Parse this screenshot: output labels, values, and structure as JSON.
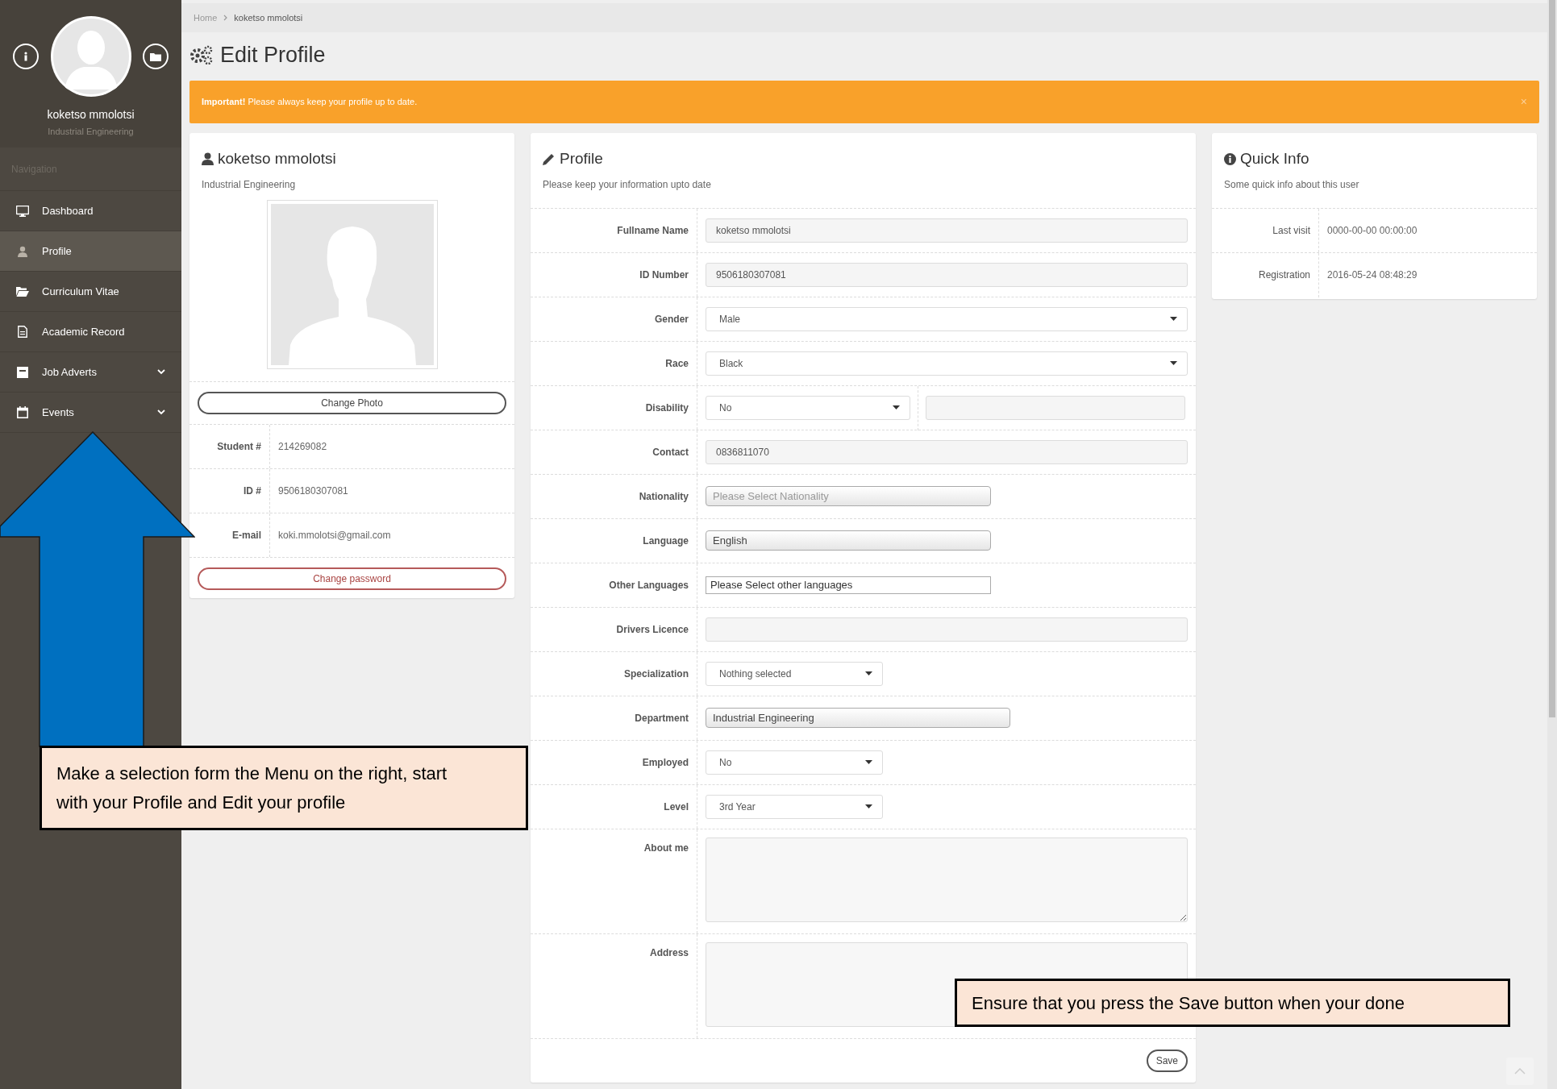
{
  "sidebar": {
    "user_name": "koketso mmolotsi",
    "department": "Industrial Engineering",
    "nav_label": "Navigation",
    "items": [
      {
        "label": "Dashboard",
        "selected": false,
        "has_submenu": false
      },
      {
        "label": "Profile",
        "selected": true,
        "has_submenu": false
      },
      {
        "label": "Curriculum Vitae",
        "selected": false,
        "has_submenu": false
      },
      {
        "label": "Academic Record",
        "selected": false,
        "has_submenu": false
      },
      {
        "label": "Job Adverts",
        "selected": false,
        "has_submenu": true
      },
      {
        "label": "Events",
        "selected": false,
        "has_submenu": true
      }
    ]
  },
  "breadcrumb": [
    "Home",
    "koketso mmolotsi"
  ],
  "page_title": "Edit Profile",
  "alert": {
    "text": "**Important!** Please always keep your profile up to date.",
    "close": "×"
  },
  "profile_card": {
    "name": "koketso mmolotsi",
    "department": "Industrial Engineering",
    "change_photo": "Change Photo",
    "details": [
      {
        "label": "Student #",
        "value": "214269082"
      },
      {
        "label": "ID #",
        "value": "9506180307081"
      },
      {
        "label": "E-mail",
        "value": "koki.mmolotsi@gmail.com"
      }
    ],
    "change_password": "Change password"
  },
  "profile_form": {
    "title": "Profile",
    "subtitle": "Please keep your information upto date",
    "rows": [
      {
        "label": "Fullname Name",
        "controls": [
          {
            "kind": "input",
            "value": "koketso mmolotsi"
          }
        ]
      },
      {
        "label": "ID Number",
        "controls": [
          {
            "kind": "input",
            "value": "9506180307081"
          }
        ]
      },
      {
        "label": "Gender",
        "controls": [
          {
            "kind": "select",
            "value": "Male"
          }
        ]
      },
      {
        "label": "Race",
        "controls": [
          {
            "kind": "select",
            "value": "Black"
          }
        ]
      },
      {
        "label": "Disability",
        "controls": [
          {
            "kind": "select",
            "value": "No"
          },
          {
            "kind": "input"
          }
        ]
      },
      {
        "label": "Contact",
        "controls": [
          {
            "kind": "input",
            "value": "0836811070"
          }
        ]
      },
      {
        "label": "Nationality",
        "controls": [
          {
            "kind": "combo",
            "placeholder": "Please Select Nationality"
          }
        ]
      },
      {
        "label": "Language",
        "controls": [
          {
            "kind": "combo",
            "value": "English"
          }
        ]
      },
      {
        "label": "Other Languages",
        "controls": [
          {
            "kind": "multiselect",
            "placeholder": "Please Select other languages"
          }
        ]
      },
      {
        "label": "Drivers Licence",
        "controls": [
          {
            "kind": "input"
          }
        ]
      },
      {
        "label": "Specialization",
        "controls": [
          {
            "kind": "shortselect",
            "value": "Nothing selected"
          }
        ]
      },
      {
        "label": "Department",
        "controls": [
          {
            "kind": "widecombo",
            "value": "Industrial Engineering"
          }
        ]
      },
      {
        "label": "Employed",
        "controls": [
          {
            "kind": "shortselect",
            "value": "No"
          }
        ]
      },
      {
        "label": "Level",
        "controls": [
          {
            "kind": "shortselect",
            "value": "3rd Year"
          }
        ]
      },
      {
        "label": "About me",
        "controls": [
          {
            "kind": "textarea"
          }
        ]
      },
      {
        "label": "Address",
        "controls": [
          {
            "kind": "textarea"
          }
        ]
      }
    ],
    "save": "Save"
  },
  "quick_info": {
    "title": "Quick Info",
    "subtitle": "Some quick info about this user",
    "rows": [
      {
        "label": "Last visit",
        "value": "0000-00-00 00:00:00"
      },
      {
        "label": "Registration",
        "value": "2016-05-24 08:48:29"
      }
    ]
  },
  "annotations": [
    {
      "text": "Make a selection form the Menu on the right, start with your Profile and Edit your profile"
    },
    {
      "text": "Ensure that you press the Save button when your done"
    }
  ]
}
